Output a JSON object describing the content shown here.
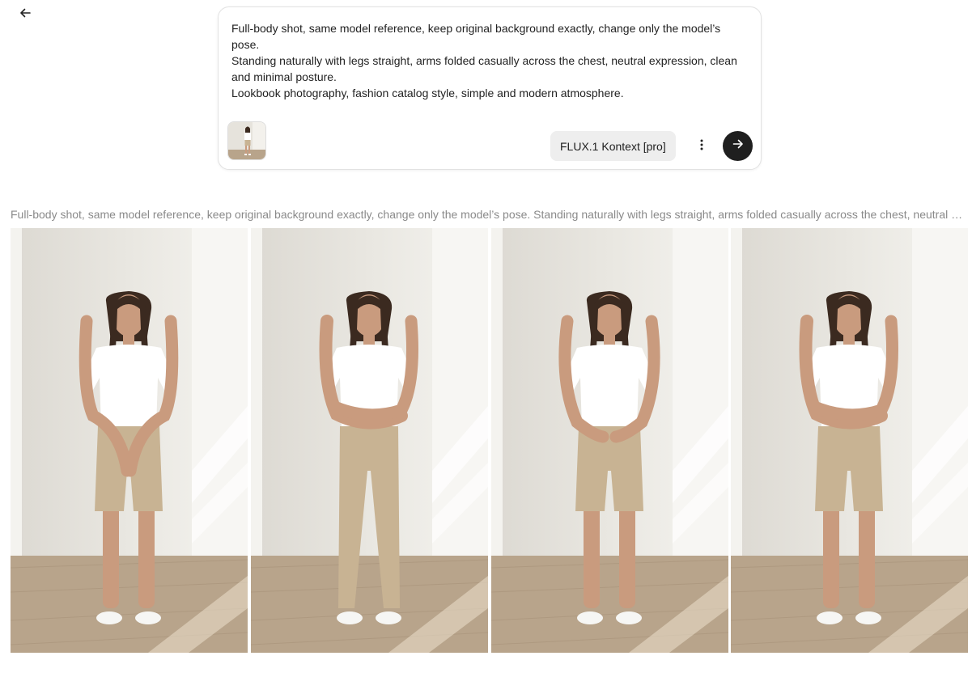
{
  "header": {
    "back_icon": "arrow-left-icon"
  },
  "prompt": {
    "lines": [
      "Full-body shot, same model reference, keep original background exactly, change only the model’s pose.",
      "Standing naturally with legs straight, arms folded casually across the chest, neutral expression, clean and minimal posture.",
      "Lookbook photography, fashion catalog style, simple and modern atmosphere."
    ],
    "reference_image": "reference-photo-thumbnail",
    "model_label": "FLUX.1 Kontext [pro]",
    "more_icon": "more-vertical-icon",
    "send_icon": "arrow-right-icon"
  },
  "result": {
    "caption": "Full-body shot, same model reference, keep original background exactly, change only the model’s pose. Standing naturally with legs straight, arms folded casually across the chest, neutral expression, clean and minimal posture. Lookbook photography, fashion catalog style, simple and modern atmosphere.",
    "images": [
      {
        "pose": "hands-clasped",
        "bottoms": "bike-shorts"
      },
      {
        "pose": "arms-folded",
        "bottoms": "trousers"
      },
      {
        "pose": "hands-at-waist",
        "bottoms": "bike-shorts"
      },
      {
        "pose": "arms-folded",
        "bottoms": "bike-shorts"
      }
    ]
  },
  "colors": {
    "wall": "#e9e7e1",
    "floor": "#b8a48b",
    "shirt": "#ffffff",
    "pants": "#c8b393",
    "skin": "#c99b7e",
    "hair": "#3b2a20",
    "send_button": "#1f1f1f"
  }
}
